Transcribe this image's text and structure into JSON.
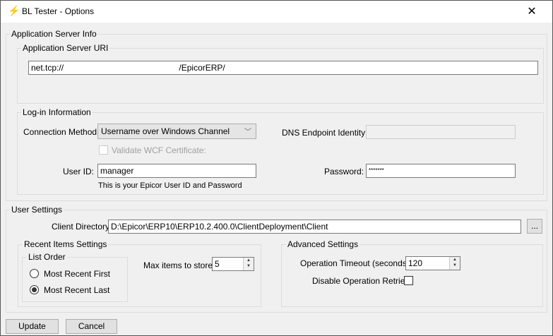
{
  "window": {
    "title": "BL Tester - Options",
    "close_icon": "close-icon"
  },
  "server_info": {
    "legend": "Application Server Info",
    "uri_legend": "Application Server URI",
    "uri_value": "net.tcp://                                                 /EpicorERP/"
  },
  "login": {
    "legend": "Log-in Information",
    "connection_method_label": "Connection Method:",
    "connection_method_value": "Username over Windows Channel",
    "dns_label": "DNS Endpoint Identity:",
    "dns_value": "",
    "validate_label": "Validate WCF Certificate:",
    "user_id_label": "User ID:",
    "user_id_value": "manager",
    "password_label": "Password:",
    "password_value": "*******",
    "hint": "This is your Epicor User ID and Password"
  },
  "user_settings": {
    "legend": "User Settings",
    "client_dir_label": "Client Directory:",
    "client_dir_value": "D:\\Epicor\\ERP10\\ERP10.2.400.0\\ClientDeployment\\Client",
    "browse_label": "...",
    "recent": {
      "legend": "Recent Items Settings",
      "list_order_legend": "List Order",
      "option_first": "Most Recent First",
      "option_last": "Most Recent Last",
      "selected": "Most Recent Last",
      "max_label": "Max items to store:",
      "max_value": "5"
    },
    "advanced": {
      "legend": "Advanced Settings",
      "timeout_label": "Operation Timeout (seconds):",
      "timeout_value": "120",
      "disable_retries_label": "Disable Operation Retries:",
      "disable_retries_checked": false
    }
  },
  "buttons": {
    "update": "Update",
    "cancel": "Cancel"
  }
}
